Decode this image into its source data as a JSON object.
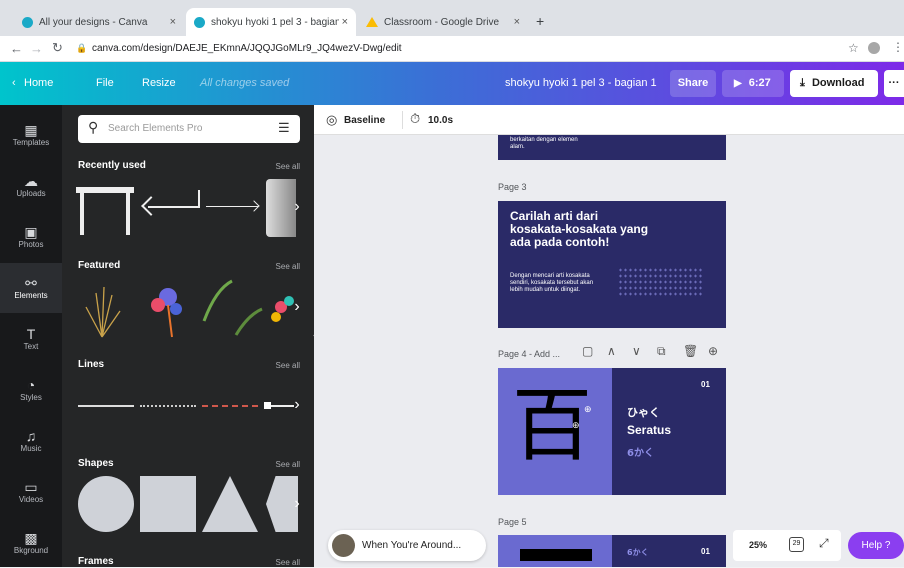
{
  "browser": {
    "tabs": [
      {
        "title": "All your designs - Canva",
        "close": "×"
      },
      {
        "title": "shokyu hyoki 1 pel 3 - bagian 1",
        "close": "×"
      },
      {
        "title": "Classroom - Google Drive",
        "close": "×"
      }
    ],
    "new_tab": "+",
    "url": "canva.com/design/DAEJE_EKmnA/JQQJGoMLr9_JQ4wezV-Dwg/edit"
  },
  "topbar": {
    "home": "Home",
    "file": "File",
    "resize": "Resize",
    "saved_status": "All changes saved",
    "design_title": "shokyu hyoki 1 pel 3 - bagian 1",
    "share": "Share",
    "play_time": "6:27",
    "download": "Download",
    "more": "···"
  },
  "rail": [
    {
      "label": "Templates",
      "icon": "templates-icon",
      "glyph": "▦"
    },
    {
      "label": "Uploads",
      "icon": "upload-cloud-icon",
      "glyph": "☁"
    },
    {
      "label": "Photos",
      "icon": "photos-icon",
      "glyph": "▣"
    },
    {
      "label": "Elements",
      "icon": "elements-icon",
      "glyph": "⚯"
    },
    {
      "label": "Text",
      "icon": "text-icon",
      "glyph": "T"
    },
    {
      "label": "Styles",
      "icon": "styles-icon",
      "glyph": "◔"
    },
    {
      "label": "Music",
      "icon": "music-icon",
      "glyph": "♫"
    },
    {
      "label": "Videos",
      "icon": "videos-icon",
      "glyph": "▭"
    },
    {
      "label": "Bkground",
      "icon": "background-icon",
      "glyph": "▩"
    }
  ],
  "panel": {
    "search_placeholder": "Search Elements Pro",
    "recently_used": "Recently used",
    "featured": "Featured",
    "lines": "Lines",
    "shapes": "Shapes",
    "frames": "Frames",
    "see_all": "See all"
  },
  "editor": {
    "baseline": "Baseline",
    "duration": "10.0s",
    "page2_text": "berkaitan dengan elemen alam.",
    "page3_label": "Page 3",
    "page3_title": "Carilah arti dari kosakata-kosakata yang ada pada contoh!",
    "page3_body": "Dengan mencari arti kosakata sendiri, kosakata tersebut akan lebih mudah untuk diingat.",
    "page4_label": "Page 4 - Add ...",
    "page4_kanji": "百",
    "page4_num": "01",
    "page4_reading": "ひゃく",
    "page4_meaning": "Seratus",
    "page4_strokes": "6かく",
    "page5_label": "Page 5",
    "page5_strokes": "6かく",
    "page5_num": "01"
  },
  "bottom": {
    "track": "When You're Around...",
    "zoom": "25%",
    "page_count": "29",
    "help": "Help ?"
  },
  "colors": {
    "canva_cyan": "#00c4cc",
    "canva_purple": "#7d2ae8",
    "slide_navy": "#2a2a67",
    "slide_lavender": "#6a6ad0"
  }
}
